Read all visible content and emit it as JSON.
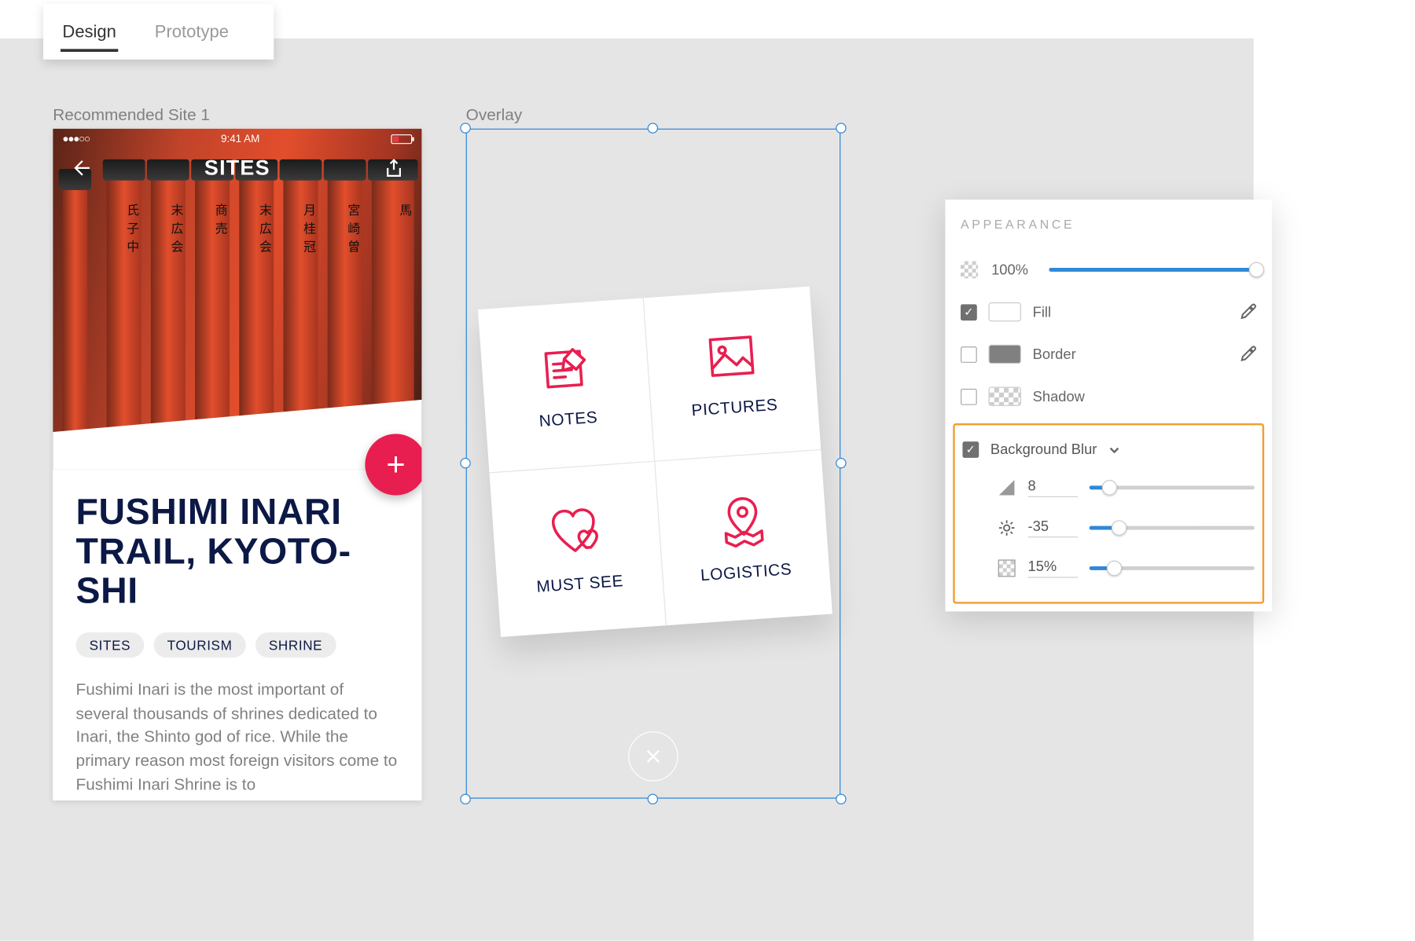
{
  "tabs": {
    "design": "Design",
    "prototype": "Prototype"
  },
  "artboard1": {
    "label": "Recommended Site 1",
    "statusTime": "9:41 AM",
    "navTitle": "SITES",
    "siteTitle": "FUSHIMI INARI TRAIL, KYOTO-SHI",
    "chips": [
      "SITES",
      "TOURISM",
      "SHRINE"
    ],
    "body": "Fushimi Inari is the most important of several thousands of shrines dedicated to Inari, the Shinto god of rice. While the primary reason most foreign visitors come to Fushimi Inari Shrine is to",
    "fab": "+",
    "pillarInk": [
      "氏子中",
      "末広会",
      "商売",
      "末広会",
      "月桂冠",
      "宮崎曽",
      "馬"
    ]
  },
  "artboard2": {
    "label": "Overlay",
    "cells": {
      "notes": "NOTES",
      "pictures": "PICTURES",
      "mustsee": "MUST SEE",
      "logistics": "LOGISTICS"
    }
  },
  "inspector": {
    "title": "APPEARANCE",
    "opacity": {
      "label": "100%",
      "pct": 100
    },
    "fill": {
      "label": "Fill",
      "checked": true,
      "color": "#ffffff"
    },
    "border": {
      "label": "Border",
      "checked": false,
      "color": "#808080"
    },
    "shadow": {
      "label": "Shadow",
      "checked": false
    },
    "bgBlur": {
      "label": "Background Blur",
      "checked": true,
      "amount": {
        "value": "8",
        "pct": 12
      },
      "brightness": {
        "value": "-35",
        "pct": 18
      },
      "opacity": {
        "value": "15%",
        "pct": 15
      }
    }
  }
}
